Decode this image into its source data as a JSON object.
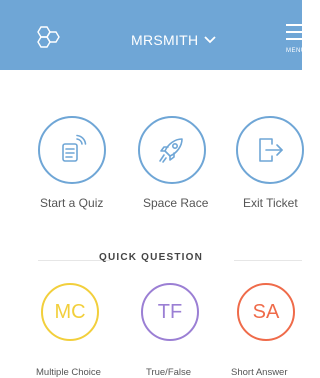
{
  "header": {
    "username": "MRSMITH",
    "menu_label": "MENU"
  },
  "activities": [
    {
      "label": "Start a Quiz",
      "icon": "quiz-icon"
    },
    {
      "label": "Space Race",
      "icon": "rocket-icon"
    },
    {
      "label": "Exit Ticket",
      "icon": "exit-icon"
    }
  ],
  "quick_question": {
    "title": "QUICK QUESTION",
    "items": [
      {
        "abbr": "MC",
        "label": "Multiple Choice",
        "color": "#f2cf3c"
      },
      {
        "abbr": "TF",
        "label": "True/False",
        "color": "#9b7fd4"
      },
      {
        "abbr": "SA",
        "label": "Short Answer",
        "color": "#ef6b4a"
      }
    ]
  },
  "colors": {
    "header_bg": "#6fa6d6",
    "activity_ring": "#6fa6d6"
  }
}
